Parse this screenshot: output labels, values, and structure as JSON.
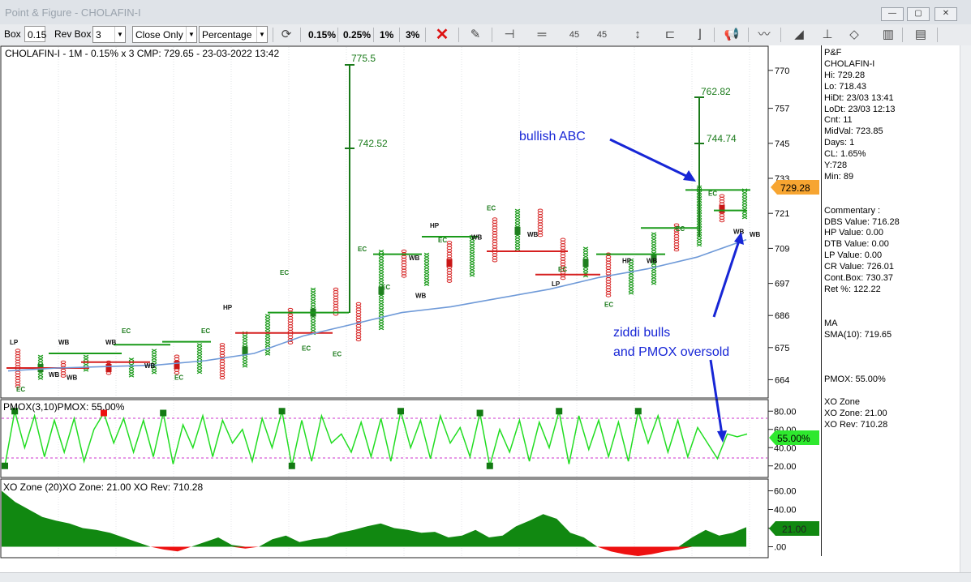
{
  "window": {
    "title": "Point & Figure - CHOLAFIN-I"
  },
  "toolbar": {
    "box_label": "Box",
    "box_value": "0.15",
    "rev_label": "Rev Box",
    "rev_value": "3",
    "close_mode": "Close Only",
    "method": "Percentage",
    "pct_buttons": [
      "0.15%",
      "0.25%",
      "1%",
      "3%"
    ],
    "badge_45_left": "45",
    "badge_45_right": "45"
  },
  "main_chart": {
    "header": "CHOLAFIN-I - 1M - 0.15% x 3 CMP: 729.65 - 23-03-2022 13:42",
    "y_ticks": [
      "770",
      "757",
      "745",
      "733",
      "721",
      "709",
      "697",
      "686",
      "675",
      "664"
    ],
    "price_tag": "729.28",
    "vertical_projection_1": {
      "top": "775.5",
      "mid": "742.52"
    },
    "vertical_projection_2": {
      "top": "762.82",
      "mid": "744.74"
    },
    "marker_labels": [
      "LP",
      "EC",
      "WB",
      "HP"
    ],
    "annotations": {
      "bullish_abc": "bullish ABC",
      "ziddi_line1": "ziddi bulls",
      "ziddi_line2": "and PMOX oversold"
    }
  },
  "pmox_panel": {
    "title": "PMOX(3,10)PMOX: 55.00%",
    "y_ticks": [
      "80.00",
      "60.00",
      "40.00",
      "20.00"
    ],
    "value_tag": "55.00%"
  },
  "xo_panel": {
    "title": "XO Zone (20)XO Zone: 21.00 XO Rev: 710.28",
    "y_ticks": [
      "60.00",
      "40.00",
      "20.00",
      ".00"
    ],
    "value_tag": "21.00"
  },
  "colors": {
    "x_green": "#1a9a1a",
    "o_red": "#d62020",
    "sma_blue": "#6f9ad8",
    "pmox_line": "#22dd22",
    "annotation_blue": "#1726d6",
    "xo_green": "#118811",
    "xo_red": "#ee1111"
  },
  "side_panel": {
    "lines": [
      "P&F",
      "CHOLAFIN-I",
      "Hi: 729.28",
      "Lo: 718.43",
      "HiDt: 23/03 13:41",
      "LoDt: 23/03 12:13",
      "Cnt: 11",
      "MidVal: 723.85",
      "Days: 1",
      "CL: 1.65%",
      "Y:728",
      "Min: 89",
      "",
      "",
      "Commentary :",
      "DBS Value:  716.28",
      "HP Value: 0.00",
      "DTB Value: 0.00",
      "LP Value: 0.00",
      "CR Value: 726.01",
      "Cont.Box: 730.37",
      "Ret %: 122.22",
      "",
      "",
      "MA",
      "SMA(10): 719.65",
      "",
      "",
      "",
      "PMOX: 55.00%",
      "",
      "XO Zone",
      "XO Zone: 21.00",
      "XO Rev: 710.28"
    ]
  },
  "chart_data": [
    {
      "type": "line",
      "title": "CHOLAFIN-I - 1M - 0.15% x 3 CMP: 729.65 - 23-03-2022 13:42",
      "description_series": "Point & Figure columns (approximate column highs/lows)",
      "ylim": [
        658,
        778
      ],
      "series": [
        {
          "name": "SMA(10)",
          "x": [
            0,
            20,
            40,
            60,
            80,
            100,
            120,
            140,
            160,
            180,
            200,
            220,
            240,
            260,
            280,
            300
          ],
          "values": [
            667,
            668,
            668.5,
            669,
            670.5,
            673,
            679,
            683,
            687,
            689,
            692,
            695,
            699,
            702,
            706,
            712
          ]
        }
      ],
      "columns": [
        {
          "dir": "O",
          "low": 661,
          "high": 674
        },
        {
          "dir": "X",
          "low": 664,
          "high": 672
        },
        {
          "dir": "O",
          "low": 665,
          "high": 670
        },
        {
          "dir": "X",
          "low": 667,
          "high": 672
        },
        {
          "dir": "O",
          "low": 666,
          "high": 670
        },
        {
          "dir": "X",
          "low": 665,
          "high": 671
        },
        {
          "dir": "X",
          "low": 666,
          "high": 674
        },
        {
          "dir": "O",
          "low": 666,
          "high": 672
        },
        {
          "dir": "X",
          "low": 666,
          "high": 676
        },
        {
          "dir": "O",
          "low": 664,
          "high": 676
        },
        {
          "dir": "X",
          "low": 668,
          "high": 680
        },
        {
          "dir": "X",
          "low": 672,
          "high": 686
        },
        {
          "dir": "O",
          "low": 676,
          "high": 688
        },
        {
          "dir": "X",
          "low": 679,
          "high": 695
        },
        {
          "dir": "O",
          "low": 686,
          "high": 695
        },
        {
          "dir": "O",
          "low": 677,
          "high": 690
        },
        {
          "dir": "X",
          "low": 681,
          "high": 708
        },
        {
          "dir": "O",
          "low": 699,
          "high": 708
        },
        {
          "dir": "X",
          "low": 696,
          "high": 707
        },
        {
          "dir": "O",
          "low": 697,
          "high": 711
        },
        {
          "dir": "X",
          "low": 699,
          "high": 713
        },
        {
          "dir": "O",
          "low": 704,
          "high": 719
        },
        {
          "dir": "X",
          "low": 708,
          "high": 722
        },
        {
          "dir": "O",
          "low": 713,
          "high": 722
        },
        {
          "dir": "O",
          "low": 698,
          "high": 712
        },
        {
          "dir": "X",
          "low": 699,
          "high": 709
        },
        {
          "dir": "O",
          "low": 692,
          "high": 707
        },
        {
          "dir": "X",
          "low": 693,
          "high": 705
        },
        {
          "dir": "X",
          "low": 697,
          "high": 714
        },
        {
          "dir": "O",
          "low": 708,
          "high": 717
        },
        {
          "dir": "X",
          "low": 710,
          "high": 730
        },
        {
          "dir": "O",
          "low": 718,
          "high": 727
        },
        {
          "dir": "X",
          "low": 719,
          "high": 729
        }
      ]
    },
    {
      "type": "line",
      "title": "PMOX(3,10)PMOX: 55.00%",
      "ylim": [
        10,
        90
      ],
      "series": [
        {
          "name": "PMOX",
          "values": [
            20,
            80,
            40,
            75,
            30,
            70,
            35,
            72,
            25,
            60,
            78,
            45,
            72,
            35,
            70,
            30,
            78,
            22,
            65,
            40,
            75,
            30,
            70,
            45,
            60,
            25,
            72,
            40,
            80,
            20,
            70,
            25,
            75,
            45,
            55,
            35,
            68,
            30,
            72,
            25,
            80,
            40,
            70,
            28,
            75,
            45,
            62,
            30,
            78,
            20,
            60,
            35,
            70,
            25,
            68,
            40,
            80,
            22,
            75,
            38,
            70,
            30,
            68,
            25,
            80,
            45,
            75,
            35,
            70,
            30,
            62,
            45,
            28,
            55,
            52,
            55
          ]
        }
      ]
    },
    {
      "type": "area",
      "title": "XO Zone (20)XO Zone: 21.00 XO Rev: 710.28",
      "ylim": [
        -10,
        70
      ],
      "series": [
        {
          "name": "XO Zone",
          "values": [
            60,
            48,
            40,
            32,
            28,
            25,
            20,
            18,
            15,
            10,
            5,
            0,
            -3,
            -5,
            0,
            5,
            10,
            2,
            -2,
            0,
            8,
            12,
            5,
            8,
            10,
            15,
            18,
            22,
            25,
            20,
            18,
            15,
            16,
            10,
            12,
            18,
            10,
            12,
            22,
            28,
            35,
            30,
            15,
            10,
            0,
            -5,
            -8,
            -10,
            -8,
            -5,
            -3,
            10,
            18,
            12,
            15,
            21
          ]
        }
      ]
    }
  ]
}
